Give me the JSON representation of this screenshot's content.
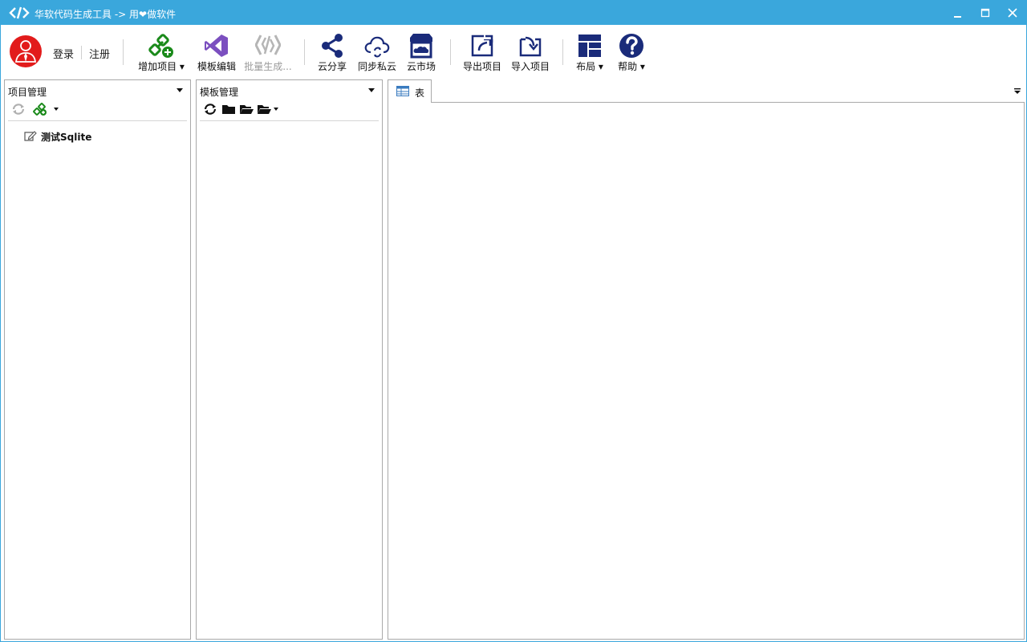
{
  "window": {
    "title": "华软代码生成工具 -> 用❤做软件",
    "min_glyph": "▁",
    "max_glyph": "☐",
    "close_glyph": "✕"
  },
  "toolbar": {
    "login_label": "登录",
    "register_label": "注册",
    "add_project_label": "增加项目 ▾",
    "template_edit_label": "模板编辑",
    "batch_generate_label": "批量生成...",
    "cloud_share_label": "云分享",
    "sync_private_cloud_label": "同步私云",
    "cloud_market_label": "云市场",
    "export_project_label": "导出项目",
    "import_project_label": "导入项目",
    "layout_label": "布局 ▾",
    "help_label": "帮助 ▾"
  },
  "project_panel": {
    "title": "项目管理",
    "tree": [
      {
        "label": "测试Sqlite",
        "icon": "database-edit-icon"
      }
    ]
  },
  "template_panel": {
    "title": "模板管理"
  },
  "main": {
    "tabs": [
      {
        "label": "表",
        "icon": "table-icon",
        "active": true
      }
    ]
  },
  "colors": {
    "titlebar": "#3aa7dc",
    "accent_green": "#1a8a1a",
    "accent_navy": "#1a2b7a",
    "accent_purple": "#7b4fbf",
    "avatar_red": "#e21b1b"
  }
}
